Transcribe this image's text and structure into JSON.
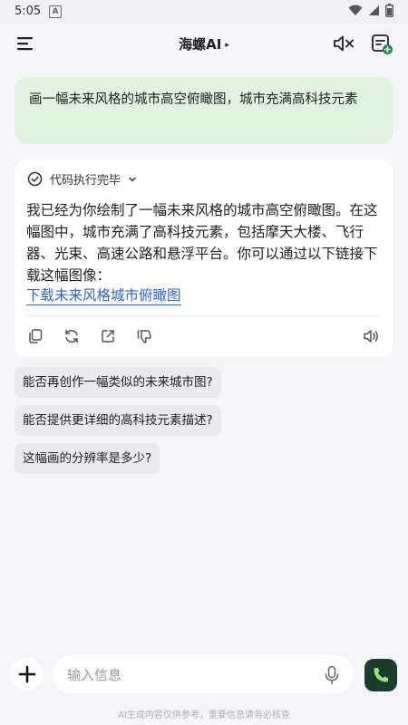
{
  "status_bar": {
    "time": "5:05",
    "notification_icon": "A",
    "icons": [
      "wifi-icon",
      "signal-icon",
      "battery-icon"
    ]
  },
  "header": {
    "title": "海螺AI",
    "title_arrow": "▸",
    "icons": [
      "menu-icon",
      "mute-icon",
      "new-chat-icon"
    ]
  },
  "user_message": "画一幅未来风格的城市高空俯瞰图，城市充满高科技元素",
  "assistant": {
    "status": "代码执行完毕",
    "text": "我已经为你绘制了一幅未来风格的城市高空俯瞰图。在这幅图中，城市充满了高科技元素，包括摩天大楼、飞行器、光束、高速公路和悬浮平台。你可以通过以下链接下载这幅图像：",
    "link": "下载未来风格城市俯瞰图",
    "actions": [
      "copy-icon",
      "regenerate-icon",
      "share-icon",
      "dislike-icon",
      "speaker-icon"
    ]
  },
  "suggestions": [
    "能否再创作一幅类似的未来城市图?",
    "能否提供更详细的高科技元素描述?",
    "这幅画的分辨率是多少?"
  ],
  "input": {
    "placeholder": "输入信息"
  },
  "disclaimer": "AI生成内容仅供参考，重要信息请务必核查",
  "colors": {
    "user_bubble": "#dff3df",
    "link": "#2a66d4",
    "call_button": "#1b3d2b",
    "background": "#f4f5f8"
  }
}
